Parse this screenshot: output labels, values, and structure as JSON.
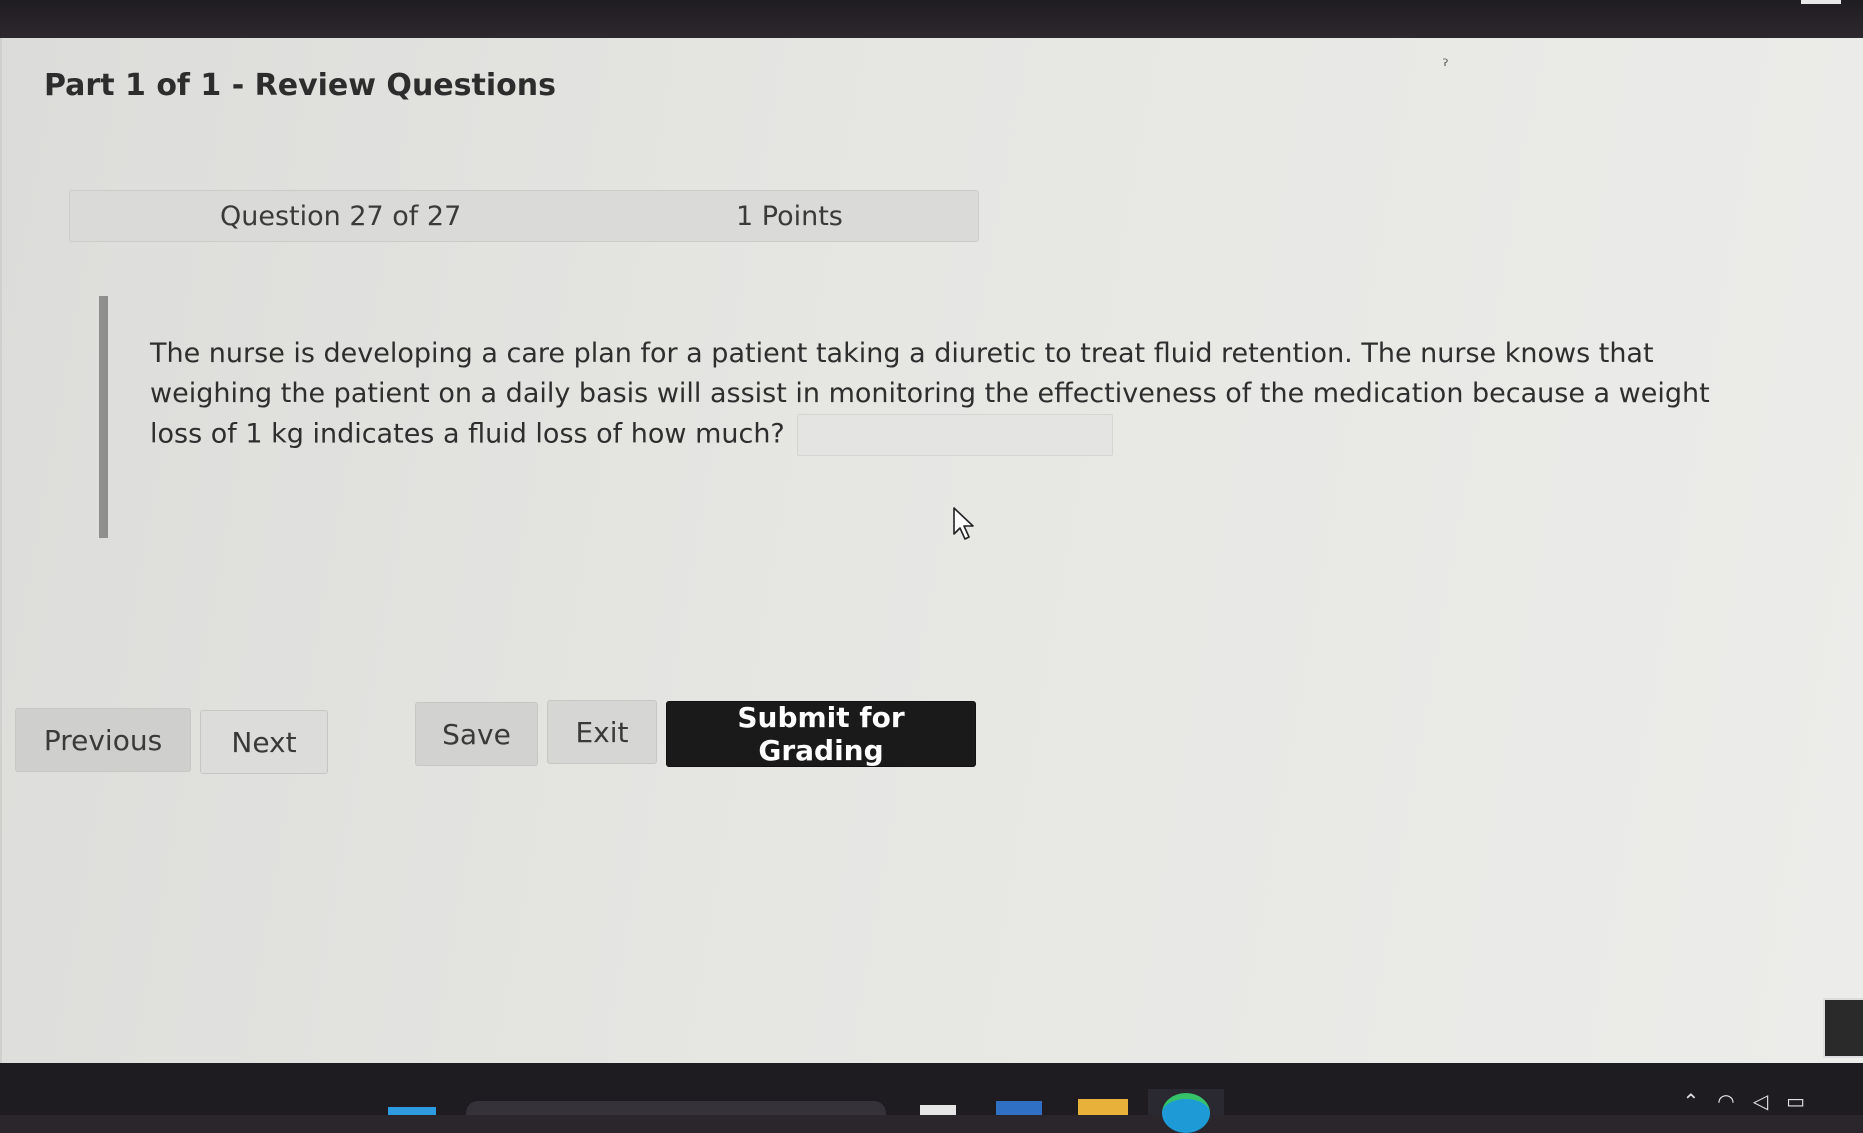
{
  "page": {
    "title": "Part 1 of 1 - Review Questions"
  },
  "question_header": {
    "number": "Question 27 of 27",
    "points": "1 Points"
  },
  "question": {
    "text": "The nurse is developing a care plan for a patient taking a diuretic to treat fluid retention. The nurse knows that weighing the patient on a daily basis will assist in monitoring the effectiveness of the medication because a weight loss of 1 kg indicates a fluid loss of how much?",
    "answer_value": "",
    "answer_placeholder": ""
  },
  "buttons": {
    "previous": "Previous",
    "next": "Next",
    "save": "Save",
    "exit": "Exit",
    "submit": "Submit for Grading"
  },
  "icons": {
    "cursor": "mouse-pointer-icon",
    "start": "windows-start-icon",
    "edge": "edge-browser-icon",
    "folder": "file-explorer-icon",
    "wifi": "wifi-icon",
    "volume": "volume-icon",
    "battery": "battery-icon"
  },
  "colors": {
    "submit_bg": "#1a1a1a",
    "submit_text": "#ffffff",
    "screen_bg": "#e6e6e3"
  }
}
